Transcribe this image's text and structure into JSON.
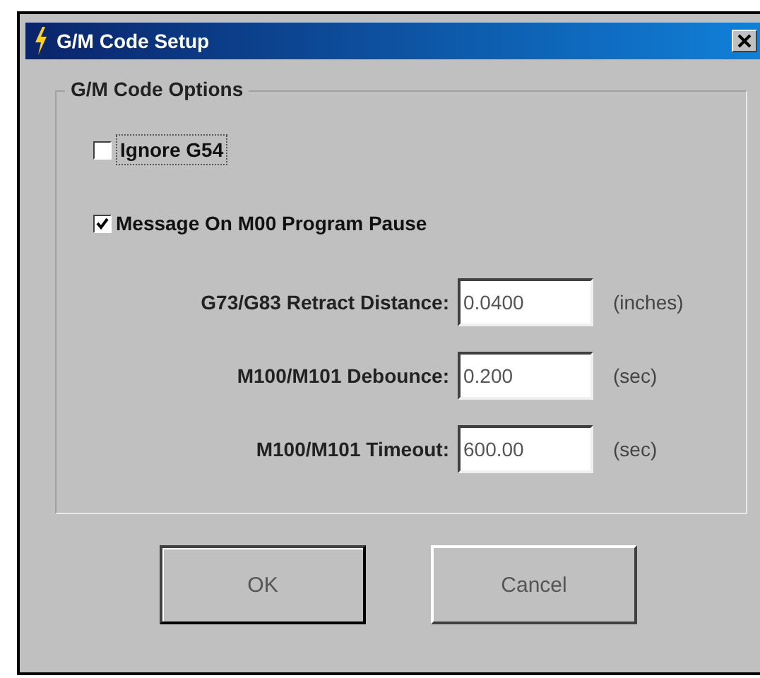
{
  "window": {
    "title": "G/M Code Setup"
  },
  "group": {
    "title": "G/M Code Options"
  },
  "options": [
    {
      "label": "Ignore G54",
      "checked": false
    },
    {
      "label": "Message On M00 Program Pause",
      "checked": true
    }
  ],
  "fields": [
    {
      "label": "G73/G83 Retract Distance:",
      "value": "0.0400",
      "unit": "(inches)"
    },
    {
      "label": "M100/M101 Debounce:",
      "value": "0.200",
      "unit": "(sec)"
    },
    {
      "label": "M100/M101 Timeout:",
      "value": "600.00",
      "unit": "(sec)"
    }
  ],
  "buttons": [
    {
      "label": "OK",
      "default": true
    },
    {
      "label": "Cancel",
      "default": false
    }
  ]
}
